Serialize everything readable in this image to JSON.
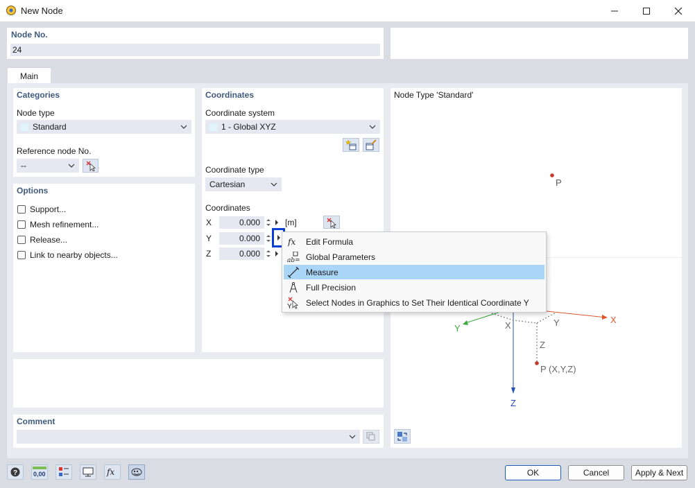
{
  "window": {
    "title": "New Node"
  },
  "node_no": {
    "label": "Node No.",
    "value": "24"
  },
  "tabs": [
    {
      "label": "Main"
    }
  ],
  "categories": {
    "title": "Categories",
    "node_type_label": "Node type",
    "node_type_value": "Standard",
    "reference_label": "Reference node No.",
    "reference_value": "--"
  },
  "options": {
    "title": "Options",
    "items": [
      "Support...",
      "Mesh refinement...",
      "Release...",
      "Link to nearby objects..."
    ]
  },
  "coordinates": {
    "title": "Coordinates",
    "system_label": "Coordinate system",
    "system_value": "1 - Global XYZ",
    "type_label": "Coordinate type",
    "type_value": "Cartesian",
    "coords_label": "Coordinates",
    "unit": "[m]",
    "rows": [
      {
        "axis": "X",
        "value": "0.000"
      },
      {
        "axis": "Y",
        "value": "0.000"
      },
      {
        "axis": "Z",
        "value": "0.000"
      }
    ]
  },
  "context_menu": {
    "items": [
      {
        "label": "Edit Formula",
        "icon": "fx-icon",
        "highlighted": false
      },
      {
        "label": "Global Parameters",
        "icon": "global-parameters-icon",
        "highlighted": false
      },
      {
        "label": "Measure",
        "icon": "measure-icon",
        "highlighted": true
      },
      {
        "label": "Full Precision",
        "icon": "compass-icon",
        "highlighted": false
      },
      {
        "label": "Select Nodes in Graphics to Set Their Identical Coordinate Y",
        "icon": "select-nodes-icon",
        "highlighted": false
      }
    ]
  },
  "preview": {
    "title": "Node Type 'Standard'",
    "point_label": "P",
    "axis_x": "X",
    "axis_y": "Y",
    "axis_z": "Z",
    "proj_x": "X",
    "proj_y": "Y",
    "proj_z": "Z",
    "point_xyz": "P (X,Y,Z)"
  },
  "comment": {
    "label": "Comment"
  },
  "footer": {
    "ok": "OK",
    "cancel": "Cancel",
    "apply_next": "Apply & Next",
    "units_icon_text": "0,00"
  },
  "colors": {
    "accent": "#0a3fd6",
    "label_blue": "#3f5a7f",
    "highlight": "#a9d5f7",
    "axis_x": "#e0542a",
    "axis_y": "#3caa3c",
    "axis_z": "#2450b8",
    "point": "#c0392b"
  }
}
